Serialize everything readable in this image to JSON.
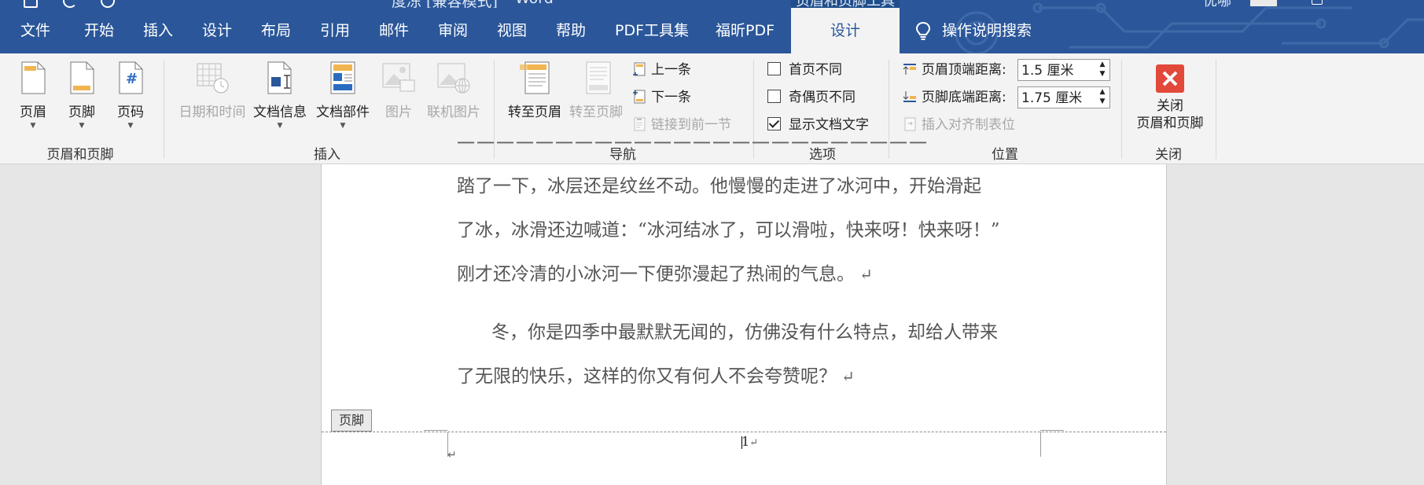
{
  "title_bar": {
    "doc_title": "度冻 [兼容模式]",
    "app_name": "Word",
    "context_tab_group": "页眉和页脚工具",
    "user_name": "优哪"
  },
  "tabs": [
    {
      "label": "文件"
    },
    {
      "label": "开始"
    },
    {
      "label": "插入"
    },
    {
      "label": "设计"
    },
    {
      "label": "布局"
    },
    {
      "label": "引用"
    },
    {
      "label": "邮件"
    },
    {
      "label": "审阅"
    },
    {
      "label": "视图"
    },
    {
      "label": "帮助"
    },
    {
      "label": "PDF工具集"
    },
    {
      "label": "福昕PDF"
    }
  ],
  "active_tab": "设计",
  "tell_me": "操作说明搜索",
  "ribbon": {
    "header_footer_group": {
      "label": "页眉和页脚",
      "header": "页眉",
      "footer": "页脚",
      "page_number": "页码"
    },
    "insert_group": {
      "label": "插入",
      "date_time": "日期和时间",
      "doc_info": "文档信息",
      "quick_parts": "文档部件",
      "pictures": "图片",
      "online_pictures": "联机图片"
    },
    "nav_group": {
      "label": "导航",
      "goto_header": "转至页眉",
      "goto_footer": "转至页脚",
      "previous": "上一条",
      "next": "下一条",
      "link_previous": "链接到前一节"
    },
    "options_group": {
      "label": "选项",
      "different_first": "首页不同",
      "different_odd_even": "奇偶页不同",
      "show_doc_text": "显示文档文字"
    },
    "position_group": {
      "label": "位置",
      "header_top_label": "页眉顶端距离:",
      "header_top_value": "1.5 厘米",
      "footer_bottom_label": "页脚底端距离:",
      "footer_bottom_value": "1.75 厘米",
      "insert_align_tab": "插入对齐制表位"
    },
    "close_group": {
      "label": "关闭",
      "close_line1": "关闭",
      "close_line2": "页眉和页脚"
    }
  },
  "document": {
    "lines": [
      "踏了一下，冰层还是纹丝不动。他慢慢的走进了冰河中，开始滑起",
      "了冰，冰滑还边喊道：“冰河结冰了，可以滑啦，快来呀！快来呀！”",
      "刚才还冷清的小冰河一下便弥漫起了热闹的气息。",
      "冬，你是四季中最默默无闻的，仿佛没有什么特点，却给人带来",
      "了无限的快乐，这样的你又有何人不会夸赞呢？"
    ],
    "para_mark": "↵",
    "footer_tag": "页脚",
    "page_number": "1"
  },
  "colors": {
    "accent": "#2b579a",
    "ribbon_bg": "#f3f3f3",
    "close_red": "#e2493a"
  }
}
